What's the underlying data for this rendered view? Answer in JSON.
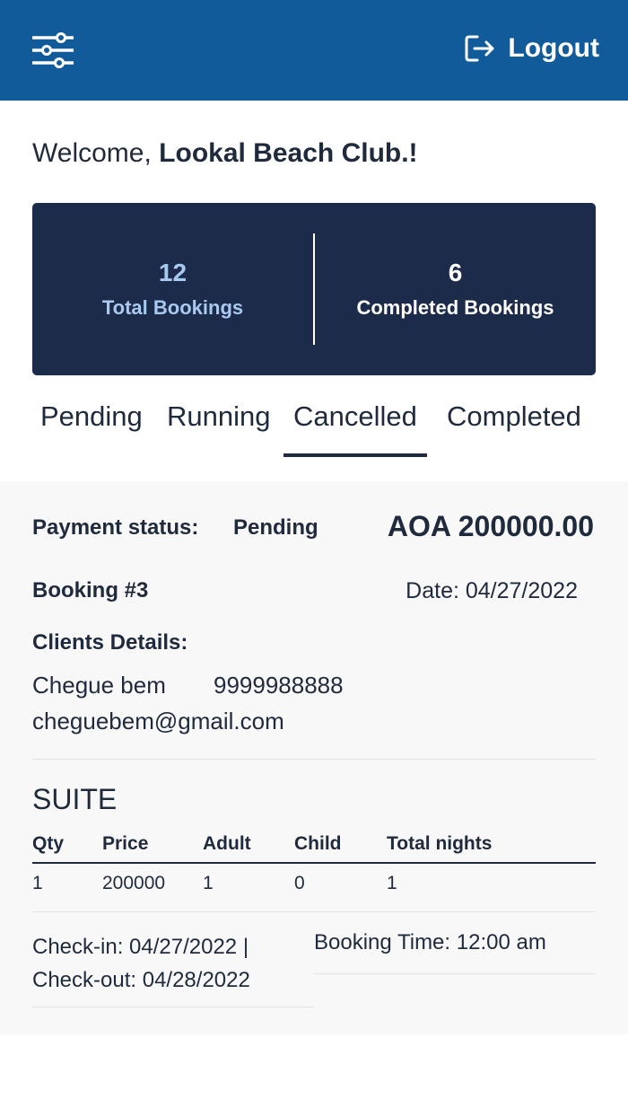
{
  "header": {
    "menu_icon": "sliders-icon",
    "logout_icon": "logout-icon",
    "logout_label": "Logout",
    "color": "#125b9b"
  },
  "welcome": {
    "prefix": "Welcome,",
    "name": "Lookal Beach Club.!"
  },
  "stats": {
    "total_value": "12",
    "total_label": "Total Bookings",
    "completed_value": "6",
    "completed_label": "Completed Bookings",
    "panel_color": "#1d2b4a"
  },
  "tabs": [
    {
      "label": "Pending",
      "active": false
    },
    {
      "label": "Running",
      "active": false
    },
    {
      "label": "Cancelled",
      "active": true
    },
    {
      "label": "Completed",
      "active": false
    }
  ],
  "booking": {
    "payment_label": "Payment status:",
    "payment_value": "Pending",
    "amount": "AOA 200000.00",
    "number": "Booking #3",
    "date": "Date: 04/27/2022",
    "clients_heading": "Clients Details:",
    "client_name": "Chegue bem",
    "client_phone": "9999988888",
    "client_email": "cheguebem@gmail.com",
    "room_type": "SUITE",
    "columns": [
      "Qty",
      "Price",
      "Adult",
      "Child",
      "Total nights"
    ],
    "row": [
      "1",
      "200000",
      "1",
      "0",
      "1"
    ],
    "checkin": "Check-in: 04/27/2022 |",
    "checkout": "Check-out: 04/28/2022",
    "booking_time": "Booking Time: 12:00 am"
  }
}
